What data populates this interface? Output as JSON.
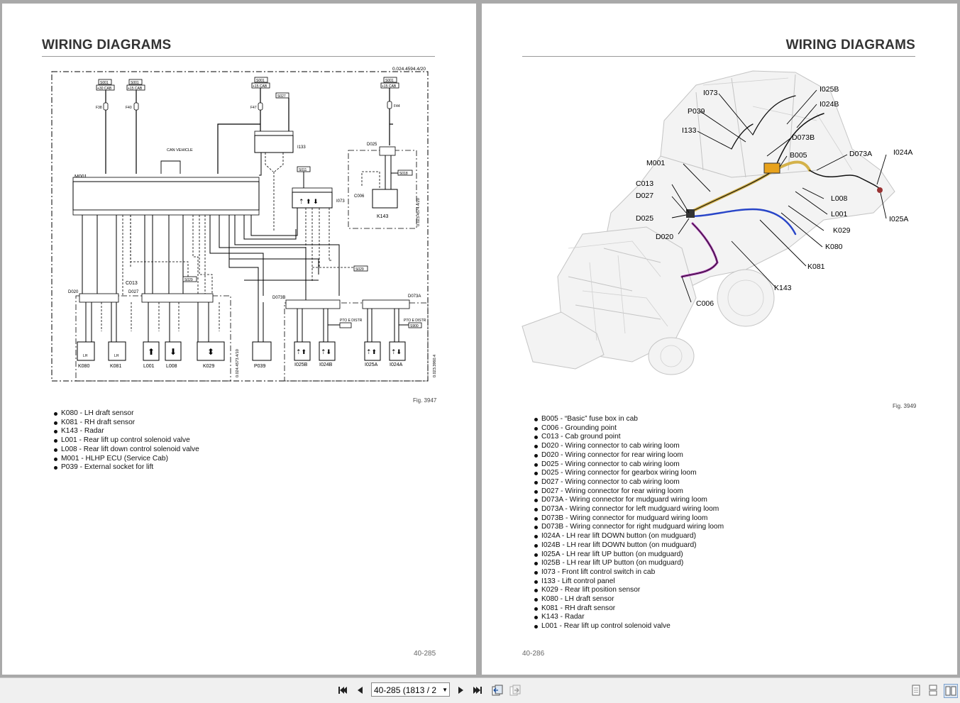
{
  "left_page": {
    "header": "WIRING DIAGRAMS",
    "figure": "Fig. 3947",
    "page_number": "40-285",
    "legend": [
      "K080 - LH draft sensor",
      "K081 - RH draft sensor",
      "K143 - Radar",
      "L001 - Rear lift up control solenoid valve",
      "L008 - Rear lift down control solenoid valve",
      "M001 - HLHP ECU (Service Cab)",
      "P039 - External socket for lift"
    ],
    "schematic": {
      "ref_top": "0.024.4594.4/20",
      "ref_side1": "0.024.4573.4/10",
      "ref_side2": "0.023.3960.4",
      "ref_side3": "0.023.4574.4/20",
      "supplies": [
        "S001",
        "S001",
        "S001",
        "S001",
        "S027",
        "S011",
        "S018",
        "S029",
        "S029"
      ],
      "supply_labels": [
        "+30 CAB",
        "+15 CAB",
        "+15 CAB",
        "+15 CAB"
      ],
      "fuses": [
        "F38",
        "F40",
        "F47",
        "F44"
      ],
      "can_label": "CAN VEHICLE",
      "can_lh": [
        "L",
        "H"
      ],
      "ecu": "M001",
      "panel": "I133",
      "switch": "I073",
      "connectors": [
        "D020",
        "D027",
        "D025",
        "D073B",
        "D073A",
        "C013",
        "C006"
      ],
      "radar": "K143",
      "pto": [
        "PTO E DISTR",
        "PTO E DISTR",
        "S900"
      ],
      "components": [
        "K080",
        "K081",
        "L001",
        "L008",
        "K029",
        "P039",
        "I025B",
        "I024B",
        "I025A",
        "I024A"
      ],
      "lh": "LH"
    }
  },
  "right_page": {
    "header": "WIRING DIAGRAMS",
    "figure": "Fig. 3949",
    "page_number": "40-286",
    "callouts": [
      "I073",
      "P039",
      "I133",
      "M001",
      "C013",
      "D027",
      "D025",
      "D020",
      "I025B",
      "I024B",
      "D073B",
      "B005",
      "D073A",
      "I024A",
      "L008",
      "L001",
      "K029",
      "K080",
      "K081",
      "K143",
      "C006",
      "I025A"
    ],
    "legend": [
      "B005 - “Basic” fuse box in cab",
      "C006 - Grounding point",
      "C013 - Cab ground point",
      "D020 - Wiring connector to cab wiring loom",
      "D020 - Wiring connector for rear wiring loom",
      "D025 - Wiring connector to cab wiring loom",
      "D025 - Wiring connector for gearbox wiring loom",
      "D027 - Wiring connector to cab wiring loom",
      "D027 - Wiring connector for rear wiring loom",
      "D073A - Wiring connector for mudguard wiring loom",
      "D073A - Wiring connector for left mudguard wiring loom",
      "D073B - Wiring connector for mudguard wiring loom",
      "D073B - Wiring connector for right mudguard wiring loom",
      "I024A - LH rear lift DOWN button (on mudguard)",
      "I024B - LH rear lift DOWN button (on mudguard)",
      "I025A - LH rear lift UP button (on mudguard)",
      "I025B - LH rear lift UP button (on mudguard)",
      "I073 - Front lift control switch in cab",
      "I133 - Lift control panel",
      "K029 - Rear lift position sensor",
      "K080 - LH draft sensor",
      "K081 - RH draft sensor",
      "K143 - Radar",
      "L001 - Rear lift up control solenoid valve"
    ]
  },
  "toolbar": {
    "page_field": "40-285 (1813 / 2"
  }
}
